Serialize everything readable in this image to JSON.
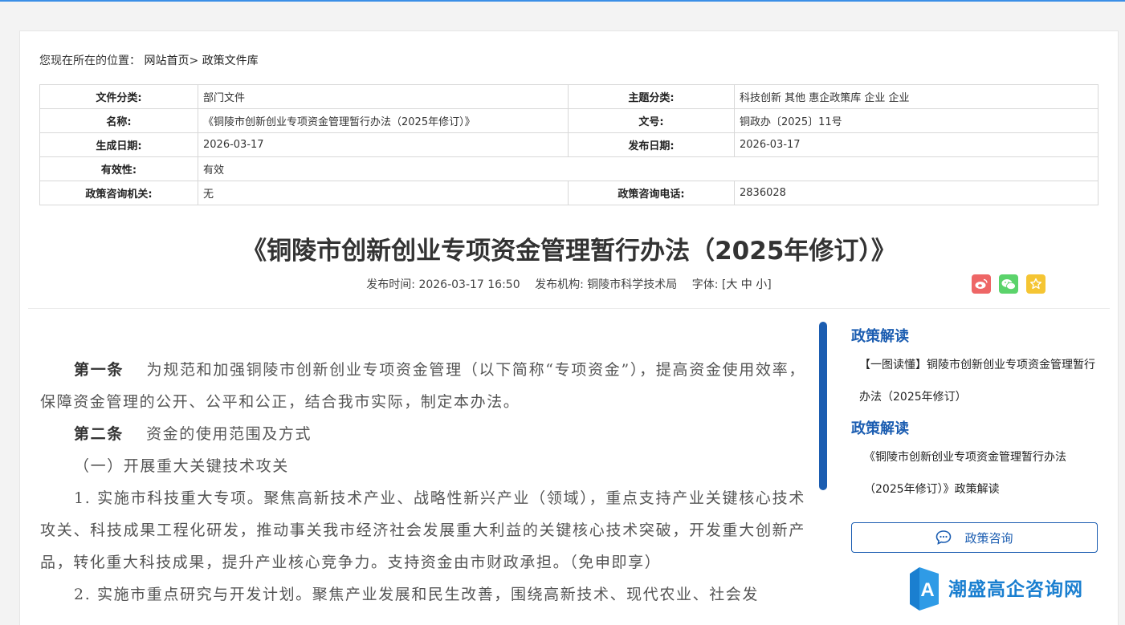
{
  "breadcrumb": {
    "prefix": "您现在所在的位置：",
    "home": "网站首页",
    "separator": ">",
    "current": "政策文件库"
  },
  "meta": {
    "category_label": "文件分类:",
    "category": "部门文件",
    "topic_label": "主题分类:",
    "topic": "科技创新 其他 惠企政策库 企业 企业",
    "name_label": "名称:",
    "name": "《铜陵市创新创业专项资金管理暂行办法（2025年修订）》",
    "docno_label": "文号:",
    "docno": "铜政办〔2025〕11号",
    "created_label": "生成日期:",
    "created": "2026-03-17",
    "published_label": "发布日期:",
    "published": "2026-03-17",
    "validity_label": "有效性:",
    "validity": "有效",
    "org_label": "政策咨询机关:",
    "org": "无",
    "phone_label": "政策咨询电话:",
    "phone": "2836028"
  },
  "doc": {
    "title": "《铜陵市创新创业专项资金管理暂行办法（2025年修订）》",
    "pubtime_label": "发布时间:",
    "pubtime": "2026-03-17 16:50",
    "publisher_label": "发布机构:",
    "publisher": "铜陵市科学技术局",
    "fontsize_label": "字体:",
    "fontsize_open": "[",
    "fontsize_large": "大",
    "fontsize_mid": "中",
    "fontsize_small": "小",
    "fontsize_close": "]"
  },
  "share_icons": [
    "weibo-icon",
    "wechat-icon",
    "star-icon"
  ],
  "content": {
    "art1_head": "第一条",
    "art1_text": "为规范和加强铜陵市创新创业专项资金管理（以下简称“专项资金”），提高资金使用效率，保障资金管理的公开、公平和公正，结合我市实际，制定本办法。",
    "art2_head": "第二条",
    "art2_text": "资金的使用范围及方式",
    "sub1": "（一）开展重大关键技术攻关",
    "item1": "1. 实施市科技重大专项。聚焦高新技术产业、战略性新兴产业（领域），重点支持产业关键核心技术攻关、科技成果工程化研发，推动事关我市经济社会发展重大利益的关键核心技术突破，开发重大创新产品，转化重大科技成果，提升产业核心竞争力。支持资金由市财政承担。（免申即享）",
    "item2": "2. 实施市重点研究与开发计划。聚焦产业发展和民生改善，围绕高新技术、现代农业、社会发"
  },
  "sidebar": {
    "section1_title": "政策解读",
    "section1_link": "【一图读懂】铜陵市创新创业专项资金管理暂行办法（2025年修订）",
    "section2_title": "政策解读",
    "section2_link": "《铜陵市创新创业专项资金管理暂行办法（2025年修订）》政策解读",
    "consult_label": "政策咨询"
  },
  "logo": {
    "letter": "A",
    "text": "潮盛高企咨询网"
  },
  "colors": {
    "accent": "#1b5db1",
    "logo_blue": "#1a7fd0",
    "weibo": "#e66666",
    "wechat": "#5bd36b",
    "favorite": "#f5c533"
  }
}
